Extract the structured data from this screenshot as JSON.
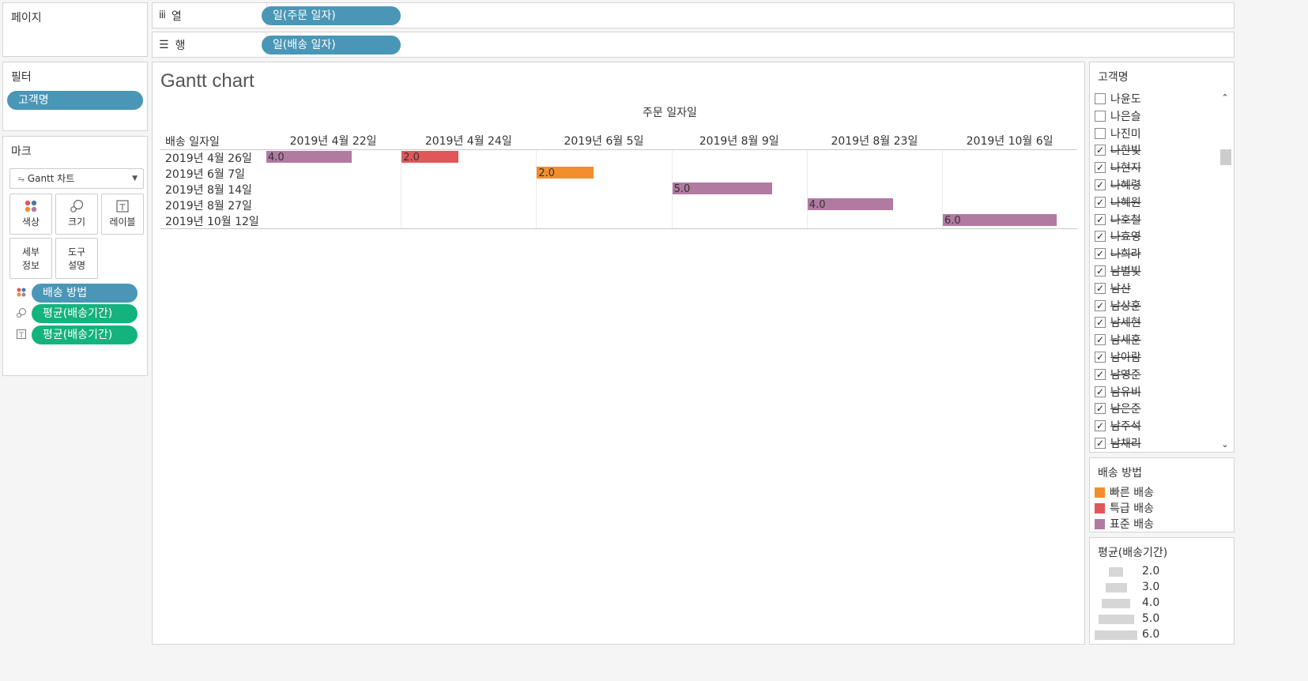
{
  "shelves": {
    "pages": "페이지",
    "columns": {
      "label": "열",
      "pill": "일(주문 일자)"
    },
    "rows": {
      "label": "행",
      "pill": "일(배송 일자)"
    }
  },
  "filters": {
    "title": "필터",
    "pill": "고객명"
  },
  "marks": {
    "title": "마크",
    "type": "Gantt 차트",
    "buttons": [
      {
        "label": "색상"
      },
      {
        "label": "크기"
      },
      {
        "label": "레이블"
      },
      {
        "label": "세부\n정보"
      },
      {
        "label": "도구\n설명"
      }
    ],
    "btn_detail_l1": "세부",
    "btn_detail_l2": "정보",
    "btn_tooltip_l1": "도구",
    "btn_tooltip_l2": "설명",
    "pills": [
      {
        "label": "배송 방법"
      },
      {
        "label": "평균(배송기간)"
      },
      {
        "label": "평균(배송기간)"
      }
    ]
  },
  "view": {
    "title": "Gantt chart",
    "col_axis_title": "주문 일자일",
    "row_axis_title": "배송 일자일"
  },
  "chart_data": {
    "type": "gantt",
    "columns": [
      "2019년 4월 22일",
      "2019년 4월 24일",
      "2019년 6월 5일",
      "2019년 8월 9일",
      "2019년 8월 23일",
      "2019년 10월 6일"
    ],
    "rows": [
      "2019년 4월 26일",
      "2019년 6월 7일",
      "2019년 8월 14일",
      "2019년 8월 27일",
      "2019년 10월 12일"
    ],
    "bars": [
      {
        "row": 0,
        "col": 0,
        "value": 4.0,
        "label": "4.0",
        "method": "표준 배송"
      },
      {
        "row": 0,
        "col": 1,
        "value": 2.0,
        "label": "2.0",
        "method": "특급 배송"
      },
      {
        "row": 1,
        "col": 2,
        "value": 2.0,
        "label": "2.0",
        "method": "빠른 배송"
      },
      {
        "row": 2,
        "col": 3,
        "value": 5.0,
        "label": "5.0",
        "method": "표준 배송"
      },
      {
        "row": 3,
        "col": 4,
        "value": 4.0,
        "label": "4.0",
        "method": "표준 배송"
      },
      {
        "row": 4,
        "col": 5,
        "value": 6.0,
        "label": "6.0",
        "method": "표준 배송"
      }
    ],
    "xlabel": "주문 일자일",
    "ylabel": "배송 일자일"
  },
  "customer_filter": {
    "title": "고객명",
    "items": [
      {
        "label": "나윤도",
        "checked": false
      },
      {
        "label": "나은슬",
        "checked": false
      },
      {
        "label": "나진미",
        "checked": false
      },
      {
        "label": "나한빛",
        "checked": true
      },
      {
        "label": "나현지",
        "checked": true
      },
      {
        "label": "나혜령",
        "checked": true
      },
      {
        "label": "나혜원",
        "checked": true
      },
      {
        "label": "나호철",
        "checked": true
      },
      {
        "label": "나효영",
        "checked": true
      },
      {
        "label": "나희라",
        "checked": true
      },
      {
        "label": "남별빛",
        "checked": true
      },
      {
        "label": "남산",
        "checked": true
      },
      {
        "label": "남상훈",
        "checked": true
      },
      {
        "label": "남세현",
        "checked": true
      },
      {
        "label": "남세훈",
        "checked": true
      },
      {
        "label": "남아람",
        "checked": true
      },
      {
        "label": "남영준",
        "checked": true
      },
      {
        "label": "남유비",
        "checked": true
      },
      {
        "label": "남은준",
        "checked": true
      },
      {
        "label": "남주석",
        "checked": true
      },
      {
        "label": "남채리",
        "checked": true
      }
    ]
  },
  "color_legend": {
    "title": "배송 방법",
    "items": [
      {
        "label": "빠른 배송",
        "color": "#f28e2b"
      },
      {
        "label": "특급 배송",
        "color": "#e15759"
      },
      {
        "label": "표준 배송",
        "color": "#b07aa1"
      }
    ]
  },
  "size_legend": {
    "title": "평균(배송기간)",
    "items": [
      {
        "label": "2.0",
        "value": 2.0
      },
      {
        "label": "3.0",
        "value": 3.0
      },
      {
        "label": "4.0",
        "value": 4.0
      },
      {
        "label": "5.0",
        "value": 5.0
      },
      {
        "label": "6.0",
        "value": 6.0
      }
    ]
  }
}
